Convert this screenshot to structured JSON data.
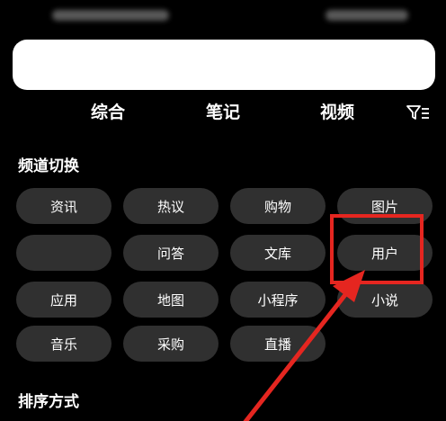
{
  "search": {
    "placeholder": ""
  },
  "tabs": [
    {
      "label": "综合"
    },
    {
      "label": "笔记"
    },
    {
      "label": "视频"
    }
  ],
  "icons": {
    "filter": "filter-icon"
  },
  "channel_section": {
    "title": "频道切换",
    "chips": [
      {
        "label": "资讯"
      },
      {
        "label": "热议"
      },
      {
        "label": "购物"
      },
      {
        "label": "图片"
      },
      {
        "label": ""
      },
      {
        "label": "问答"
      },
      {
        "label": "文库"
      },
      {
        "label": "用户"
      },
      {
        "label": "应用"
      },
      {
        "label": "地图"
      },
      {
        "label": "小程序"
      },
      {
        "label": "小说"
      },
      {
        "label": "音乐"
      },
      {
        "label": "采购"
      },
      {
        "label": "直播"
      }
    ]
  },
  "sort_section": {
    "title": "排序方式"
  },
  "colors": {
    "background": "#000000",
    "chip": "#303030",
    "annotation": "#e52620"
  }
}
